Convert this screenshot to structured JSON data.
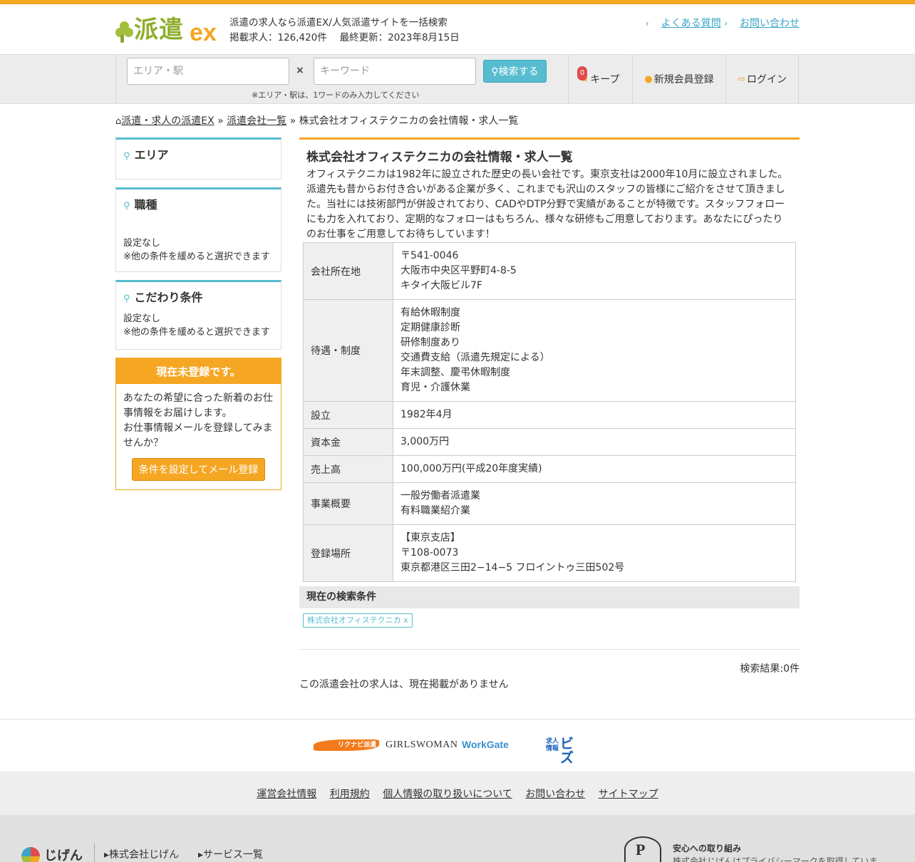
{
  "header": {
    "logo_word": "派遣",
    "logo_ex": "ex",
    "tagline1": "派遣の求人なら派遣EX/人気派遣サイトを一括検索",
    "tagline2": "掲載求人：126,420件　 最終更新：2023年8月15日",
    "links": [
      {
        "label": "よくある質問"
      },
      {
        "label": "お問い合わせ"
      }
    ]
  },
  "search": {
    "area_placeholder": "エリア・駅",
    "times": "×",
    "keyword_placeholder": "キーワード",
    "button_label": "検索する",
    "note": "※エリア・駅は、1ワードのみ入力してください",
    "keep_count": "0",
    "keep_label": "キープ",
    "register_label": "新規会員登録",
    "login_label": "ログイン"
  },
  "breadcrumb": {
    "home": "派遣・求人の派遣EX",
    "sep": "»",
    "list": "派遣会社一覧",
    "current": "株式会社オフィステクニカの会社情報・求人一覧"
  },
  "sidebar": {
    "area": {
      "title": "エリア"
    },
    "job": {
      "title": "職種",
      "line1": "設定なし",
      "line2": "※他の条件を緩めると選択できます"
    },
    "kodawari": {
      "title": "こだわり条件",
      "line1": "設定なし",
      "line2": "※他の条件を緩めると選択できます"
    },
    "register": {
      "heading": "現在未登録です。",
      "text1": "あなたの希望に合った新着のお仕事情報をお届けします。",
      "text2": "お仕事情報メールを登録してみませんか？",
      "button": "条件を設定してメール登録"
    }
  },
  "company": {
    "title": "株式会社オフィステクニカの会社情報・求人一覧",
    "description": "オフィステクニカは1982年に設立された歴史の長い会社です。東京支社は2000年10月に設立されました。派遣先も昔からお付き合いがある企業が多く、これまでも沢山のスタッフの皆様にご紹介をさせて頂きました。当社には技術部門が併設されており、CADやDTP分野で実績があることが特徴です。スタッフフォローにも力を入れており、定期的なフォローはもちろん、様々な研修もご用意しております。あなたにぴったりのお仕事をご用意してお待ちしています！",
    "rows": [
      {
        "label": "会社所在地",
        "lines": [
          "〒541-0046",
          "大阪市中央区平野町4-8-5",
          "キタイ大阪ビル7F"
        ]
      },
      {
        "label": "待遇・制度",
        "lines": [
          "有給休暇制度",
          "定期健康診断",
          "研修制度あり",
          "交通費支給（派遣先規定による）",
          "年末調整、慶弔休暇制度",
          "育児・介護休業"
        ]
      },
      {
        "label": "設立",
        "lines": [
          "1982年4月"
        ]
      },
      {
        "label": "資本金",
        "lines": [
          "3,000万円"
        ]
      },
      {
        "label": "売上高",
        "lines": [
          "100,000万円(平成20年度実績)"
        ]
      },
      {
        "label": "事業概要",
        "lines": [
          "一般労働者派遣業",
          "有料職業紹介業"
        ]
      },
      {
        "label": "登録場所",
        "lines": [
          "【東京支店】",
          "〒108-0073",
          "東京都港区三田2−14−5 フロイントゥ三田502号"
        ]
      }
    ]
  },
  "conditions": {
    "heading": "現在の検索条件",
    "chip": "株式会社オフィステクニカ",
    "chip_close": "x",
    "result_count": "検索結果:0件",
    "no_jobs": "この派遣会社の求人は、現在掲載がありません"
  },
  "partners": {
    "rikunabi": "リクナビ派遣",
    "girls": "GIRLSWOMAN",
    "workgate": "WorkGate",
    "biz_small1": "求人",
    "biz_small2": "情報",
    "biz": "ビズ"
  },
  "footer": {
    "links": [
      "運営会社情報",
      "利用規約",
      "個人情報の取り扱いについて",
      "お問い合わせ",
      "サイトマップ"
    ],
    "brand": "じげん",
    "link_company": "株式会社じげん",
    "link_services": "サービス一覧",
    "anshin_title": "安心への取り組み",
    "anshin_text": "株式会社じげんはプライバシーマークを取得していま"
  }
}
